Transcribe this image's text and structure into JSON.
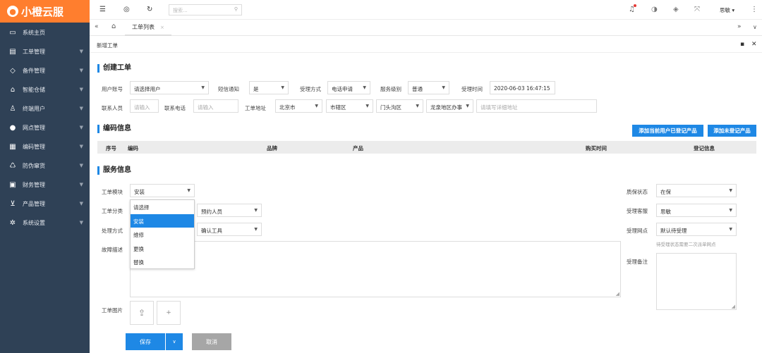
{
  "app": {
    "logo_text": "小橙云服",
    "brand_color": "#ff7e2e",
    "accent_color": "#1e88e5"
  },
  "sidebar": {
    "items": [
      {
        "label": "系统主页",
        "icon": "monitor-icon"
      },
      {
        "label": "工单管理",
        "icon": "document-icon"
      },
      {
        "label": "备件管理",
        "icon": "parts-icon"
      },
      {
        "label": "智能仓储",
        "icon": "warehouse-icon"
      },
      {
        "label": "终端用户",
        "icon": "user-icon"
      },
      {
        "label": "网点管理",
        "icon": "location-icon"
      },
      {
        "label": "编码管理",
        "icon": "grid-icon"
      },
      {
        "label": "防伪窜货",
        "icon": "shield-icon"
      },
      {
        "label": "财务管理",
        "icon": "money-icon"
      },
      {
        "label": "产品管理",
        "icon": "cart-icon"
      },
      {
        "label": "系统设置",
        "icon": "gear-icon"
      }
    ]
  },
  "topbar": {
    "search_placeholder": "搜索...",
    "user_name": "思敏"
  },
  "tabs": [
    {
      "label": "工单列表"
    }
  ],
  "page": {
    "breadcrumb": "新增工单"
  },
  "create": {
    "title": "创建工单",
    "user_account_label": "用户账号",
    "user_account_value": "请选择用户",
    "sms_label": "短信通知",
    "sms_value": "是",
    "accept_method_label": "受理方式",
    "accept_method_value": "电话申请",
    "service_level_label": "服务级别",
    "service_level_value": "普通",
    "accept_time_label": "受理时间",
    "accept_time_value": "2020-06-03 16:47:15",
    "contact_label": "联系人员",
    "contact_placeholder": "请输入",
    "phone_label": "联系电话",
    "phone_placeholder": "请输入",
    "address_label": "工单地址",
    "city": "北京市",
    "district_level": "市辖区",
    "district": "门头沟区",
    "office": "龙泉地区办事",
    "address_placeholder": "请填写详细地址"
  },
  "code": {
    "title": "编码信息",
    "add_registered_btn": "添加当前用户已登记产品",
    "add_unregistered_btn": "添加未登记产品",
    "columns": [
      "序号",
      "编码",
      "品牌",
      "产品",
      "购买时间",
      "登记信息"
    ]
  },
  "service": {
    "title": "服务信息",
    "module_label": "工单模块",
    "module_value": "安装",
    "category_label": "工单分类",
    "appointment_value": "预约人员",
    "method_label": "处理方式",
    "confirm_tool_value": "确认工具",
    "fault_label": "故障描述",
    "dropdown_options": [
      "请选择",
      "安装",
      "维修",
      "更换",
      "替换"
    ],
    "warranty_label": "质保状态",
    "warranty_value": "在保",
    "service_staff_label": "受理客服",
    "service_staff_value": "思敏",
    "service_point_label": "受理网点",
    "service_point_value": "默认待受理",
    "service_point_hint": "待受理状态需要二次派单网点",
    "remark_label": "受理备注",
    "image_label": "工单图片"
  },
  "actions": {
    "save": "保存",
    "cancel": "取消"
  }
}
